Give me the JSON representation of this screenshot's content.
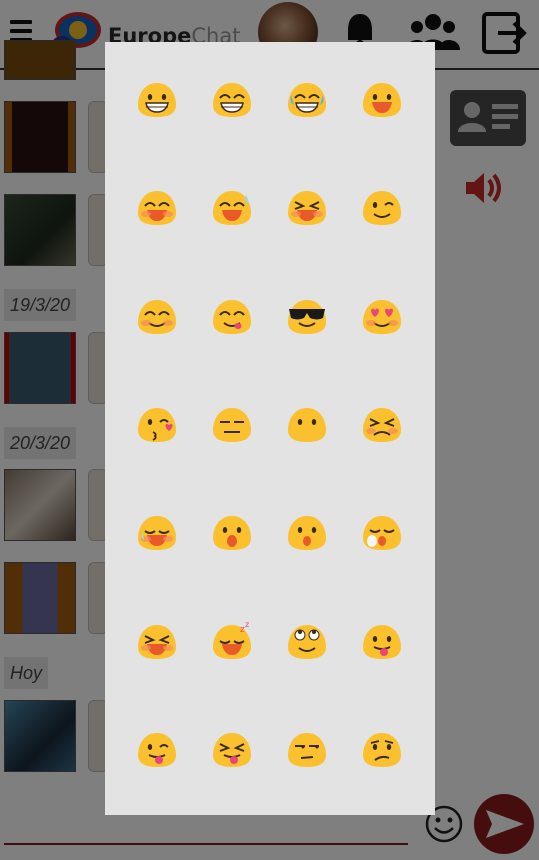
{
  "header": {
    "title_main": "Europe",
    "title_sub": "Chat"
  },
  "chat_list": {
    "date_labels": [
      "19/3/20",
      "20/3/20",
      "Hoy"
    ]
  },
  "emoji_panel": {
    "emojis": [
      {
        "name": "grinning-face-icon"
      },
      {
        "name": "grinning-squinting-face-icon"
      },
      {
        "name": "face-with-tears-of-joy-icon"
      },
      {
        "name": "smiling-face-open-mouth-icon"
      },
      {
        "name": "smiling-face-smiling-eyes-open-mouth-icon"
      },
      {
        "name": "grinning-face-with-sweat-icon"
      },
      {
        "name": "laughing-face-icon"
      },
      {
        "name": "winking-face-icon"
      },
      {
        "name": "smiling-face-smiling-eyes-icon"
      },
      {
        "name": "face-savoring-food-icon"
      },
      {
        "name": "smiling-face-sunglasses-icon"
      },
      {
        "name": "heart-eyes-face-icon"
      },
      {
        "name": "kissing-face-heart-icon"
      },
      {
        "name": "expressionless-face-icon"
      },
      {
        "name": "face-without-mouth-icon"
      },
      {
        "name": "persevering-face-icon"
      },
      {
        "name": "disappointed-relieved-face-icon"
      },
      {
        "name": "face-open-mouth-icon"
      },
      {
        "name": "hushed-face-icon"
      },
      {
        "name": "sleepy-face-icon"
      },
      {
        "name": "tired-face-icon"
      },
      {
        "name": "sleeping-face-icon"
      },
      {
        "name": "relieved-face-rolling-eyes-icon"
      },
      {
        "name": "face-with-tongue-icon"
      },
      {
        "name": "winking-face-tongue-icon"
      },
      {
        "name": "squinting-face-tongue-icon"
      },
      {
        "name": "unamused-face-icon"
      },
      {
        "name": "confused-face-icon"
      }
    ]
  },
  "colors": {
    "emoji_yellow": "#fbc02d",
    "accent": "#8b1a1a",
    "panel_bg": "#e3e3e3"
  }
}
